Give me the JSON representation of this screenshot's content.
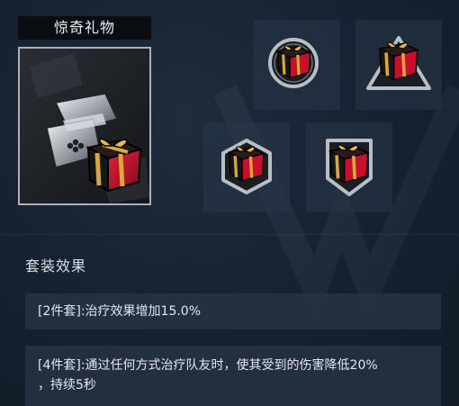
{
  "item": {
    "title": "惊奇礼物",
    "main_icon": "gift-box-with-disk-icon"
  },
  "variants": [
    {
      "icon": "gift-round-frame-icon"
    },
    {
      "icon": "gift-triangle-frame-icon"
    },
    {
      "icon": "gift-hexagon-frame-icon"
    },
    {
      "icon": "gift-square-frame-icon"
    }
  ],
  "set_effect": {
    "heading": "套装效果",
    "two_piece": "[2件套]:治疗效果增加15.0%",
    "four_piece_line1": "[4件套]:通过任何方式治疗队友时，使其受到的伤害降低20%",
    "four_piece_line2": "，持续5秒"
  },
  "colors": {
    "gift_red": "#c8102e",
    "gift_black": "#15161a",
    "ribbon_gold": "#d8a93a",
    "frame_silver": "#b8bec6"
  }
}
